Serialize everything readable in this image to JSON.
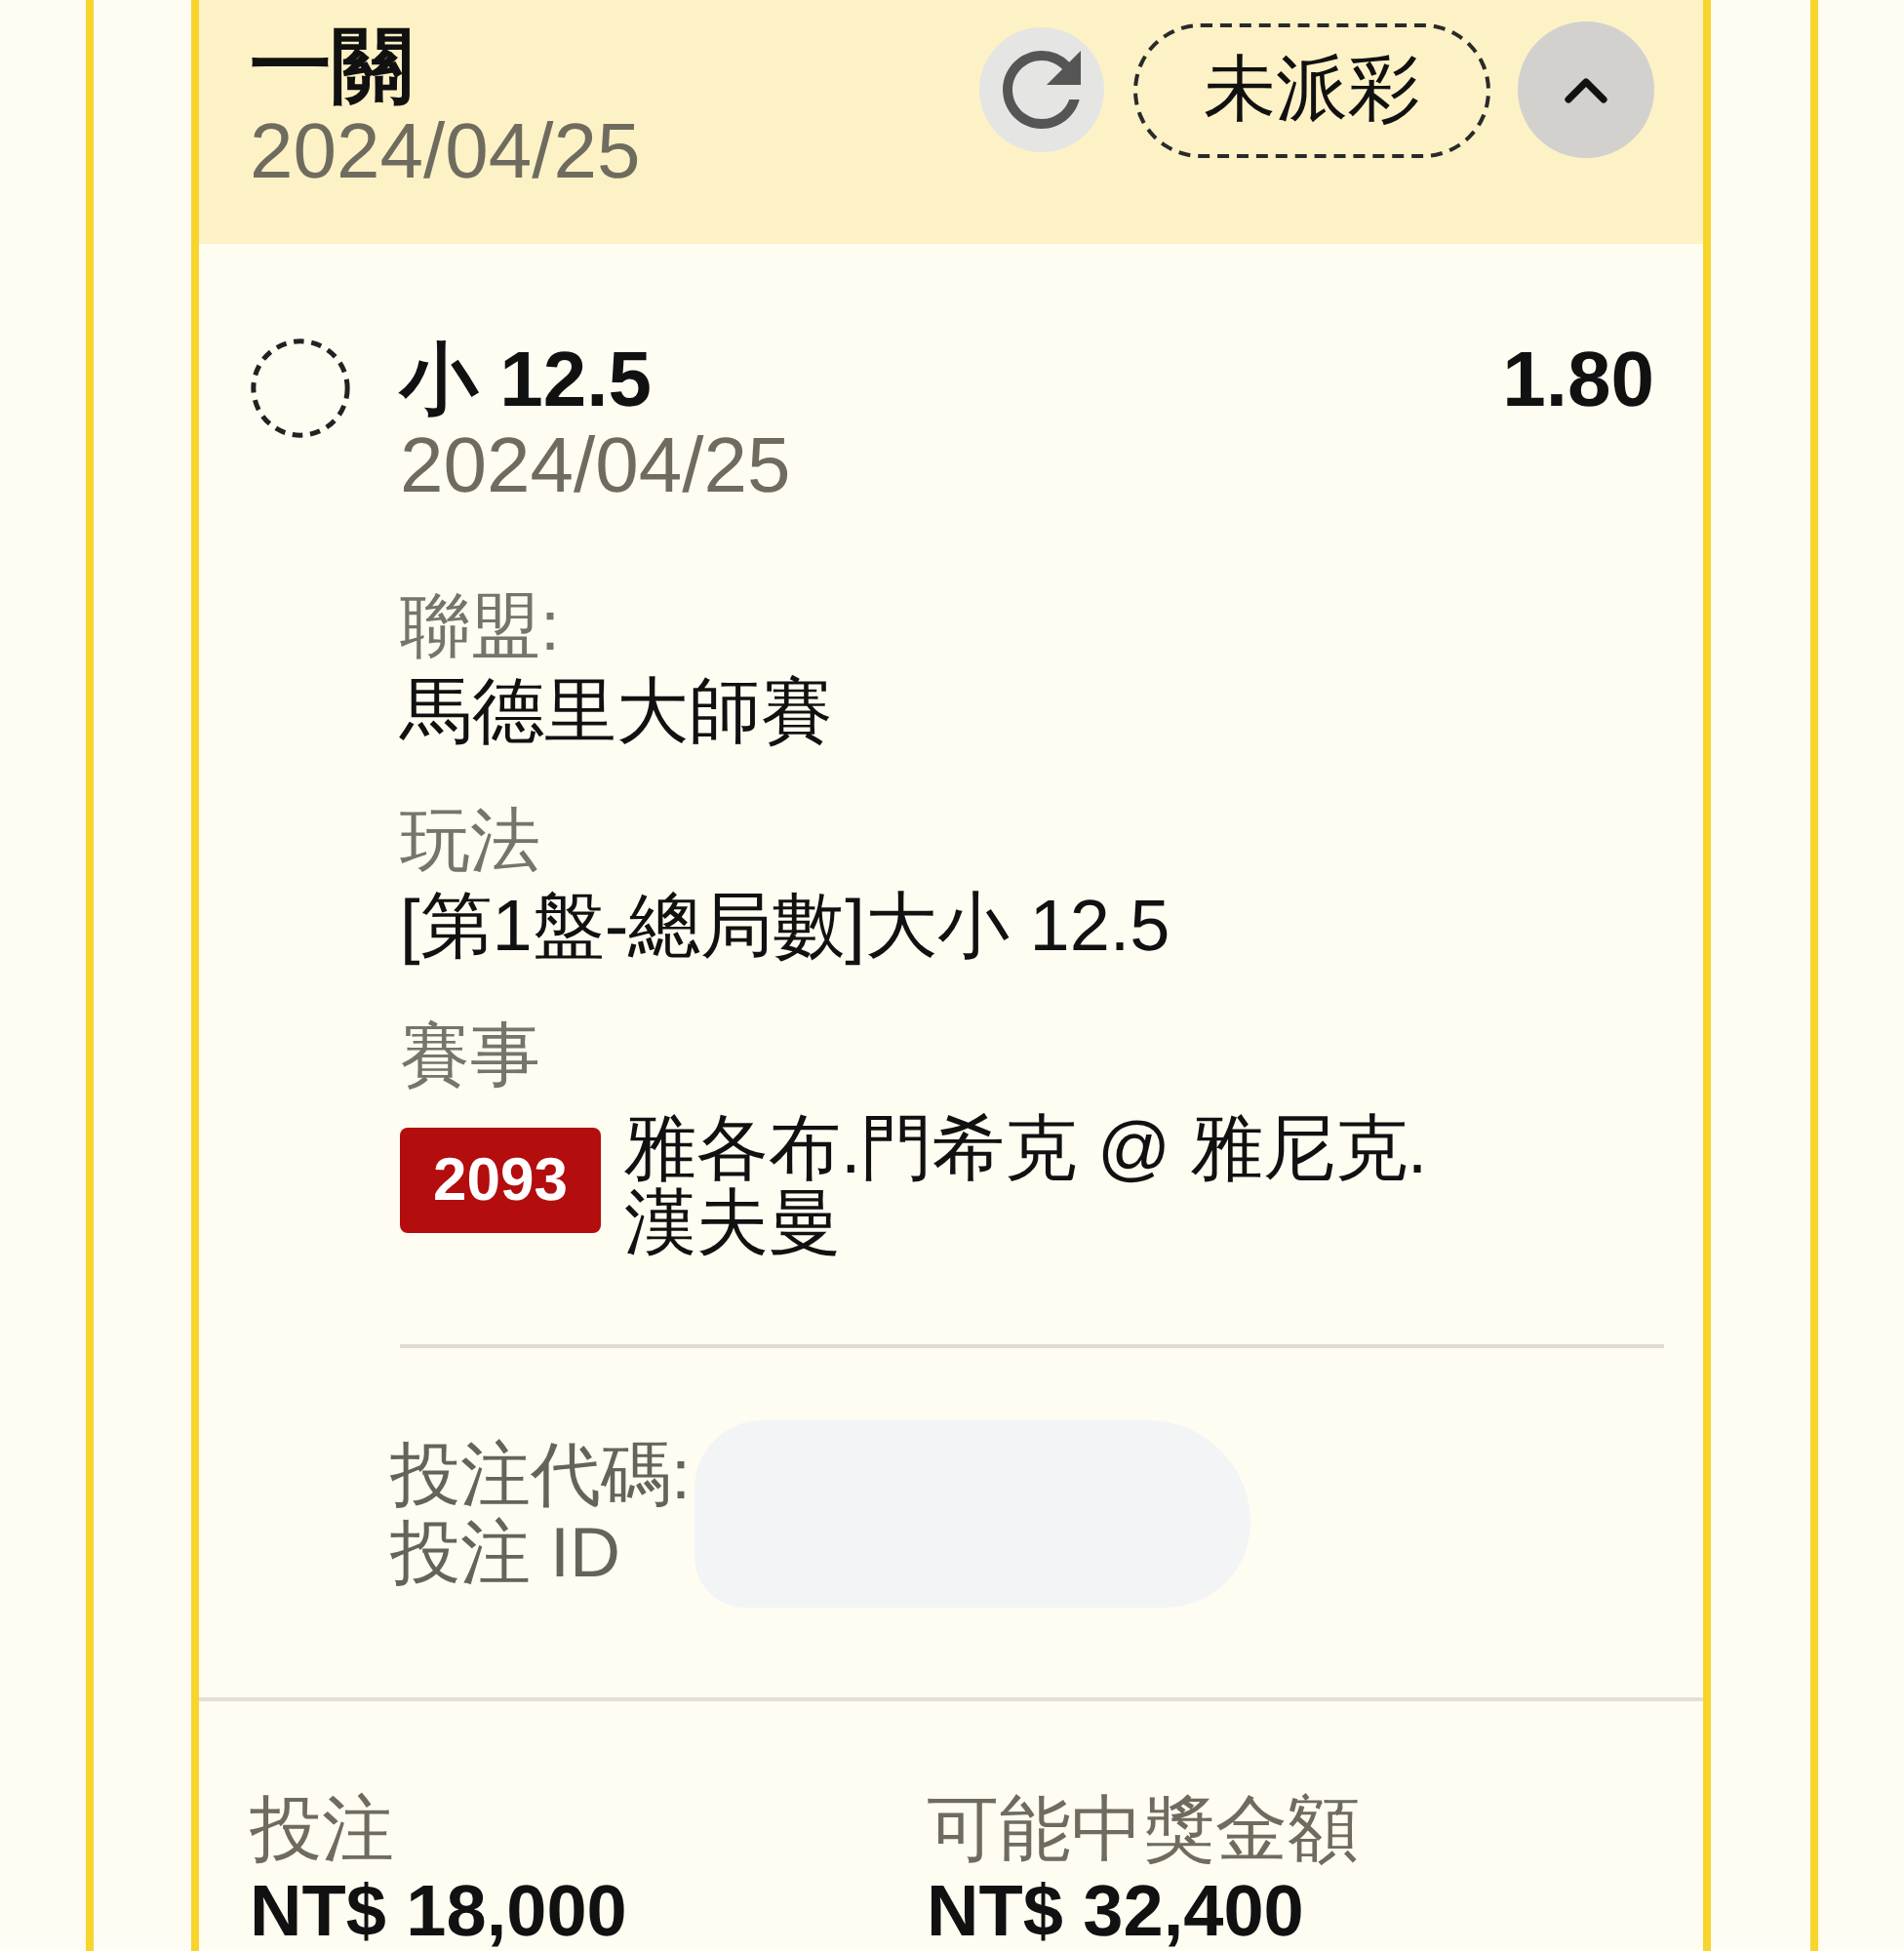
{
  "header": {
    "title": "一關",
    "date": "2024/04/25",
    "status": "未派彩",
    "expanded": true
  },
  "selection": {
    "name": "小 12.5",
    "odds": "1.80",
    "date": "2024/04/25"
  },
  "details": [
    {
      "kind": "text",
      "label": "聯盟:",
      "value": "馬德里大師賽"
    },
    {
      "kind": "text",
      "label": "玩法",
      "value": "[第1盤-總局數]大小 12.5"
    },
    {
      "kind": "event",
      "label": "賽事",
      "badge": "2093",
      "value": "雅各布.門希克 @ 雅尼克.漢夫曼"
    }
  ],
  "references": [
    "投注代碼:",
    "投注 ID"
  ],
  "summary": [
    {
      "label": "投注",
      "amount": "NT$ 18,000"
    },
    {
      "label": "可能中獎金額",
      "amount": "NT$ 32,400"
    }
  ]
}
